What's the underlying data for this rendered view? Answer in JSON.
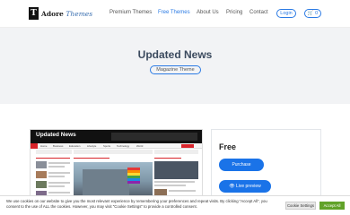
{
  "brand": {
    "name": "Adore",
    "suffix": "Themes",
    "mark": "T"
  },
  "nav": {
    "items": [
      {
        "label": "Premium Themes",
        "active": false
      },
      {
        "label": "Free Themes",
        "active": true
      },
      {
        "label": "About Us",
        "active": false
      },
      {
        "label": "Pricing",
        "active": false
      },
      {
        "label": "Contact",
        "active": false
      }
    ],
    "login_label": "Login",
    "cart_count": "0"
  },
  "hero": {
    "title": "Updated News",
    "badge": "Magazine Theme"
  },
  "preview": {
    "site_title": "Updated News",
    "menu": [
      "Home",
      "Business",
      "Education",
      "Lifestyle",
      "Sports",
      "Technology",
      "World"
    ]
  },
  "card": {
    "price": "Free",
    "purchase_label": "Purchase",
    "live_label": "Live preview"
  },
  "cookie": {
    "text": "We use cookies on our website to give you the most relevant experience by remembering your preferences and repeat visits. By clicking “Accept All”, you consent to the use of ALL the cookies. However, you may visit \"Cookie Settings\" to provide a controlled consent.",
    "settings_label": "Cookie Settings",
    "accept_label": "Accept All"
  },
  "colors": {
    "accent": "#1a73e8",
    "accept": "#61a229",
    "hero_bg": "#f2f3f5"
  }
}
